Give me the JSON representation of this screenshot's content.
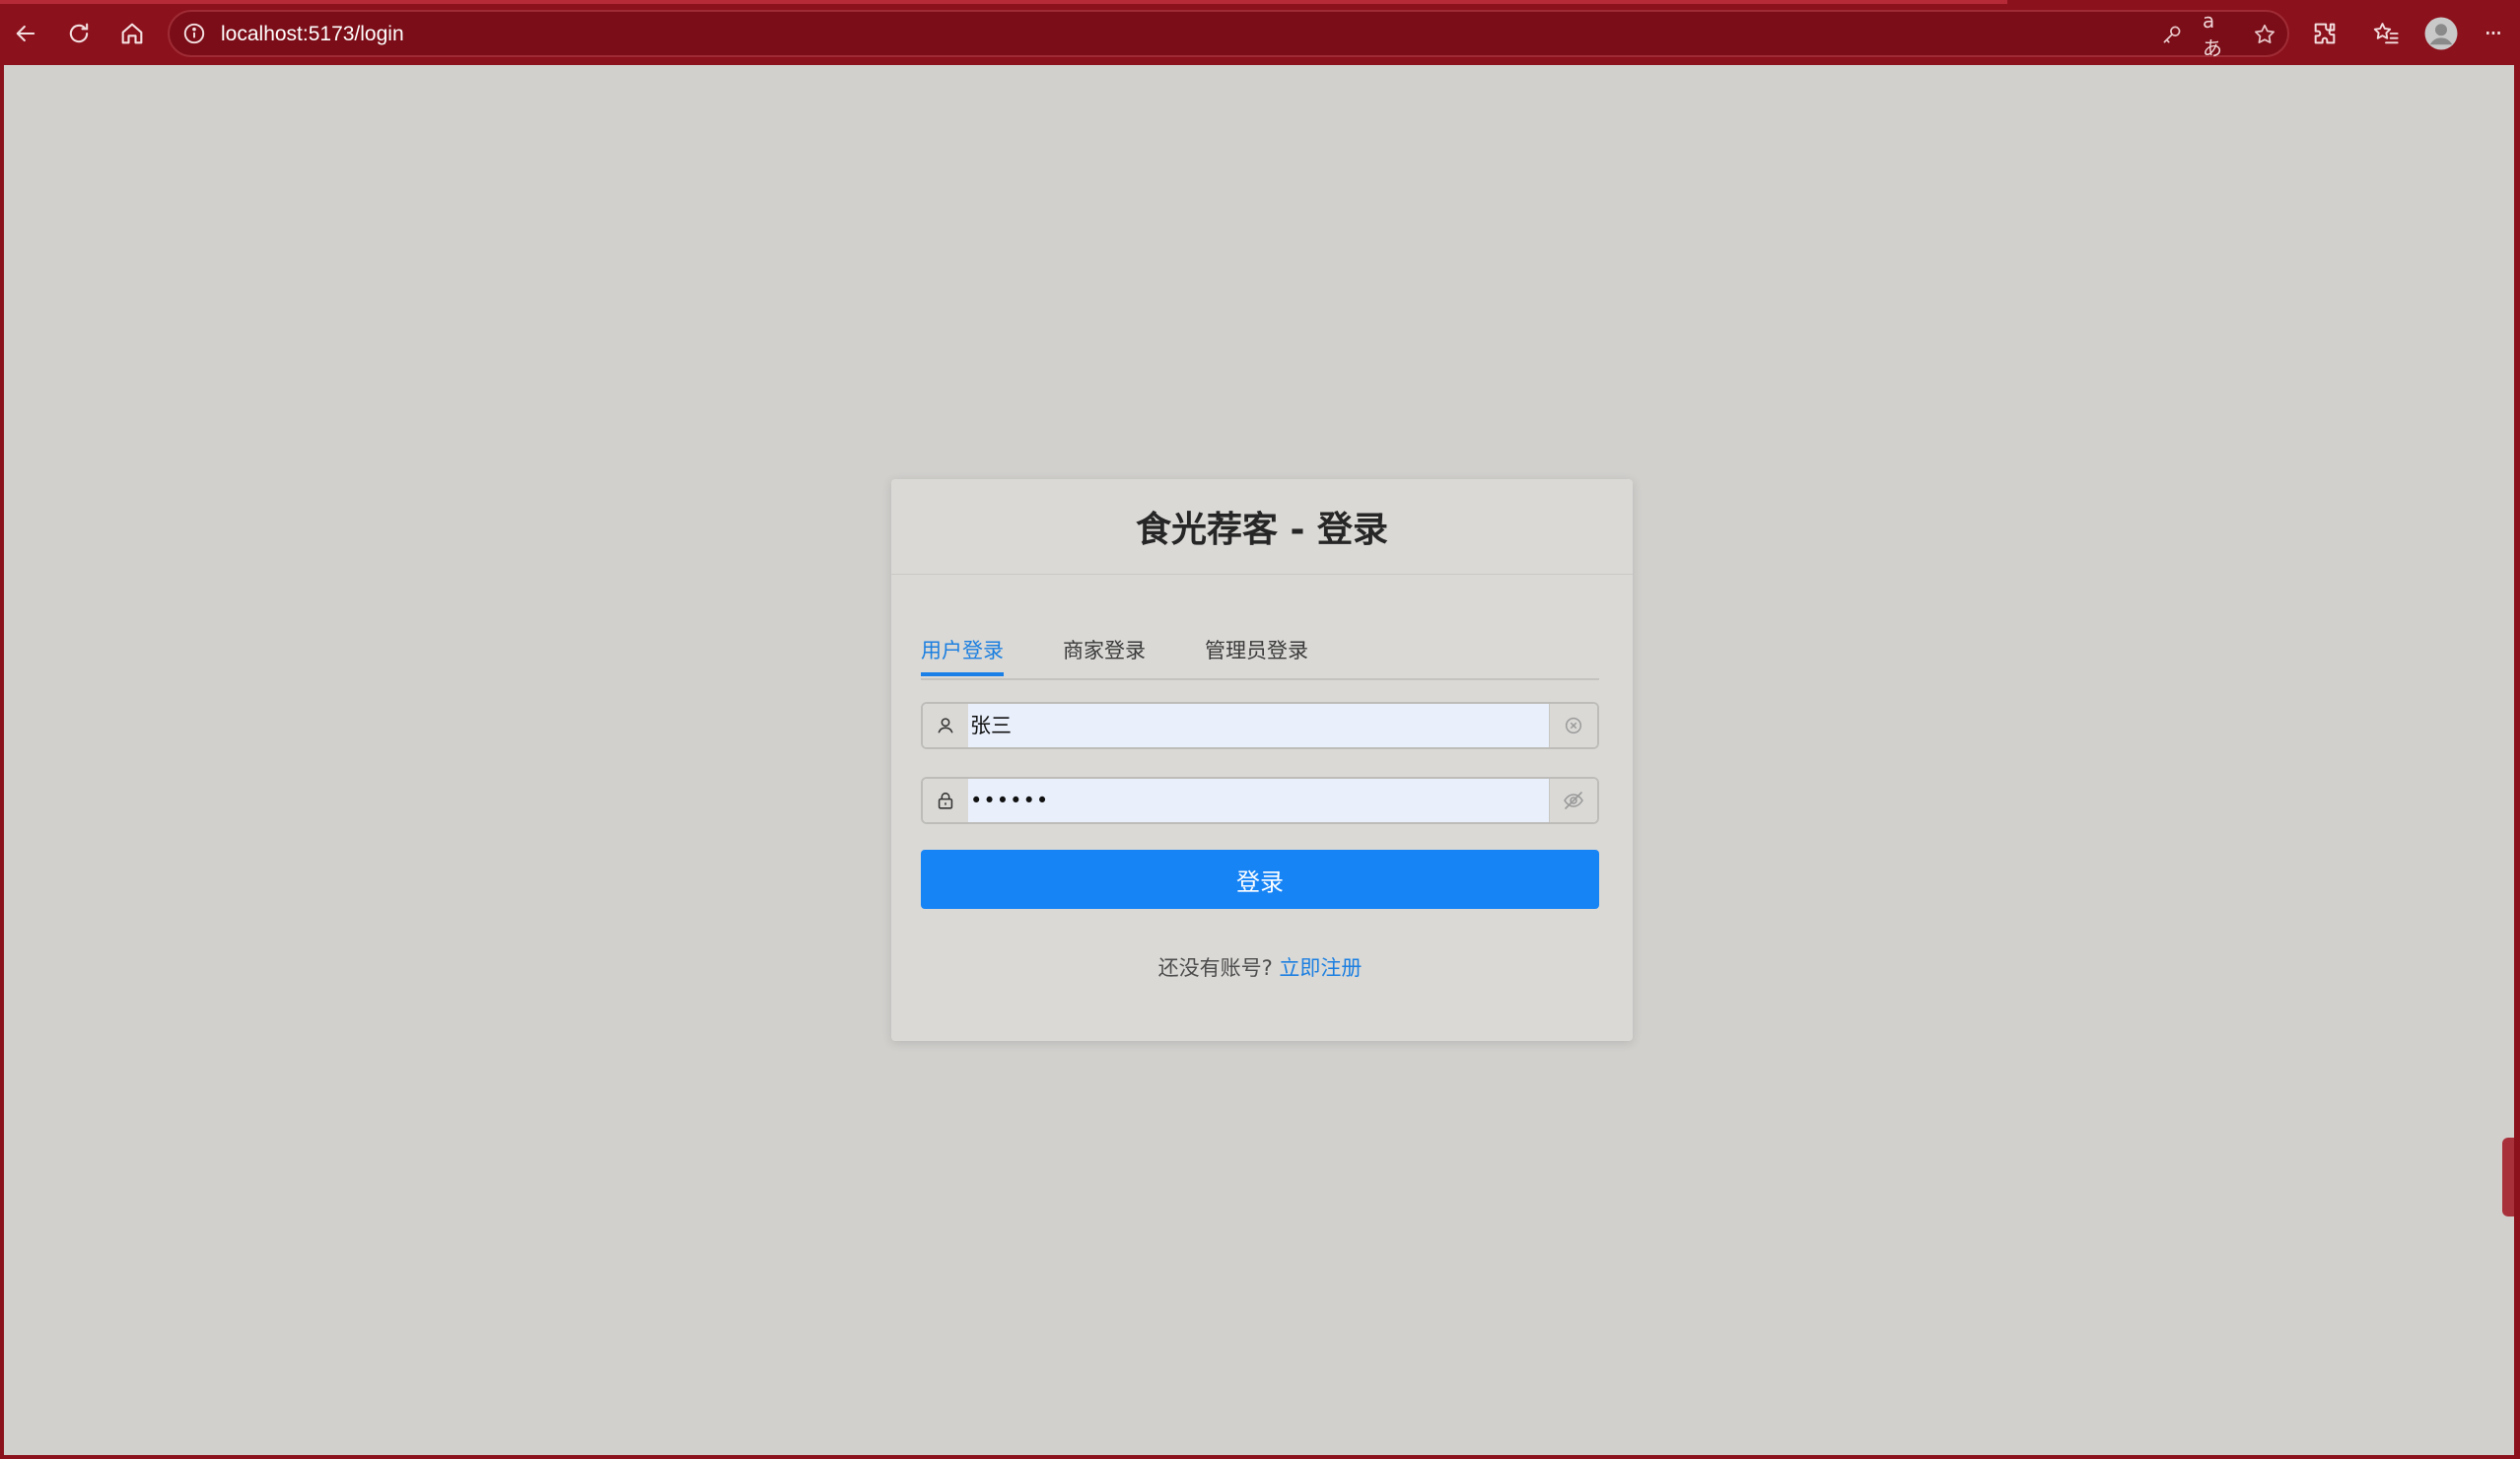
{
  "browser": {
    "url": "localhost:5173/login",
    "toolbar_icons": [
      "back-arrow-icon",
      "refresh-icon",
      "home-icon",
      "info-icon",
      "key-icon",
      "translate-icon",
      "star-icon",
      "extensions-icon",
      "favorites-icon",
      "profile-icon",
      "more-icon"
    ],
    "translate_label": "aあ",
    "more_label": "···"
  },
  "colors": {
    "browser_frame": "#8b111c",
    "page_background": "#d1d0cd",
    "primary": "#1784f5",
    "active_tab": "#1c7fe0"
  },
  "login": {
    "title": "食光荐客 - 登录",
    "tabs": [
      {
        "label": "用户登录",
        "active": true
      },
      {
        "label": "商家登录",
        "active": false
      },
      {
        "label": "管理员登录",
        "active": false
      }
    ],
    "username_value": "张三",
    "password_value": "••••••",
    "submit_label": "登录",
    "register_prompt": "还没有账号?",
    "register_link": "立即注册"
  }
}
